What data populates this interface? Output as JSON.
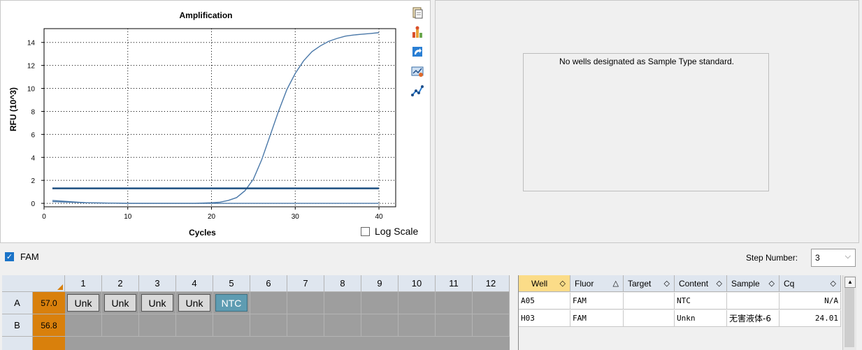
{
  "chart_data": {
    "type": "line",
    "title": "Amplification",
    "xlabel": "Cycles",
    "ylabel": "RFU (10^3)",
    "xlim": [
      0,
      42
    ],
    "ylim": [
      -0.3,
      15.2
    ],
    "xticks": [
      0,
      10,
      20,
      30,
      40
    ],
    "yticks": [
      0,
      2,
      4,
      6,
      8,
      10,
      12,
      14
    ],
    "grid": true,
    "series": [
      {
        "color": "#4a78a8",
        "x": [
          1,
          5,
          10,
          15,
          18,
          20,
          21,
          22,
          23,
          24,
          25,
          26,
          27,
          28,
          29,
          30,
          31,
          32,
          33,
          34,
          35,
          36,
          37,
          38,
          39,
          40
        ],
        "y": [
          0.25,
          0.05,
          0.0,
          0.0,
          0.0,
          0.05,
          0.1,
          0.25,
          0.5,
          1.1,
          2.1,
          3.8,
          5.9,
          8.0,
          9.9,
          11.3,
          12.4,
          13.2,
          13.7,
          14.1,
          14.35,
          14.55,
          14.65,
          14.72,
          14.78,
          14.85
        ]
      },
      {
        "color": "#4a78a8",
        "x": [
          1,
          5,
          10,
          20,
          30,
          40
        ],
        "y": [
          0.15,
          0.05,
          0.0,
          0.0,
          0.0,
          0.0
        ]
      }
    ],
    "threshold": {
      "value": 1.3,
      "color": "#1d4f80"
    },
    "log_scale_label": "Log Scale",
    "log_scale_checked": false
  },
  "toolbar_icons": [
    "copy-icon",
    "export-chart-icon",
    "refresh-icon",
    "chart-settings-icon",
    "trace-styles-icon"
  ],
  "standard_curve": {
    "message": "No wells designated as Sample Type standard."
  },
  "fluor_filter": {
    "label": "FAM",
    "checked": true
  },
  "step_number": {
    "label": "Step Number:",
    "value": "3"
  },
  "plate": {
    "columns": [
      "1",
      "2",
      "3",
      "4",
      "5",
      "6",
      "7",
      "8",
      "9",
      "10",
      "11",
      "12"
    ],
    "rows": [
      {
        "label": "A",
        "temp": "57.0",
        "wells": [
          "Unk",
          "Unk",
          "Unk",
          "Unk",
          "NTC",
          "",
          "",
          "",
          "",
          "",
          "",
          ""
        ]
      },
      {
        "label": "B",
        "temp": "56.8",
        "wells": [
          "",
          "",
          "",
          "",
          "",
          "",
          "",
          "",
          "",
          "",
          "",
          ""
        ]
      }
    ]
  },
  "table": {
    "headers": [
      {
        "label": "Well",
        "sort": "◇"
      },
      {
        "label": "Fluor",
        "sort": "△"
      },
      {
        "label": "Target",
        "sort": "◇"
      },
      {
        "label": "Content",
        "sort": "◇"
      },
      {
        "label": "Sample",
        "sort": "◇"
      },
      {
        "label": "Cq",
        "sort": "◇"
      }
    ],
    "rows": [
      [
        "A05",
        "FAM",
        "",
        "NTC",
        "",
        "N/A"
      ],
      [
        "H03",
        "FAM",
        "",
        "Unkn",
        "无害液体-6",
        "24.01"
      ]
    ]
  }
}
